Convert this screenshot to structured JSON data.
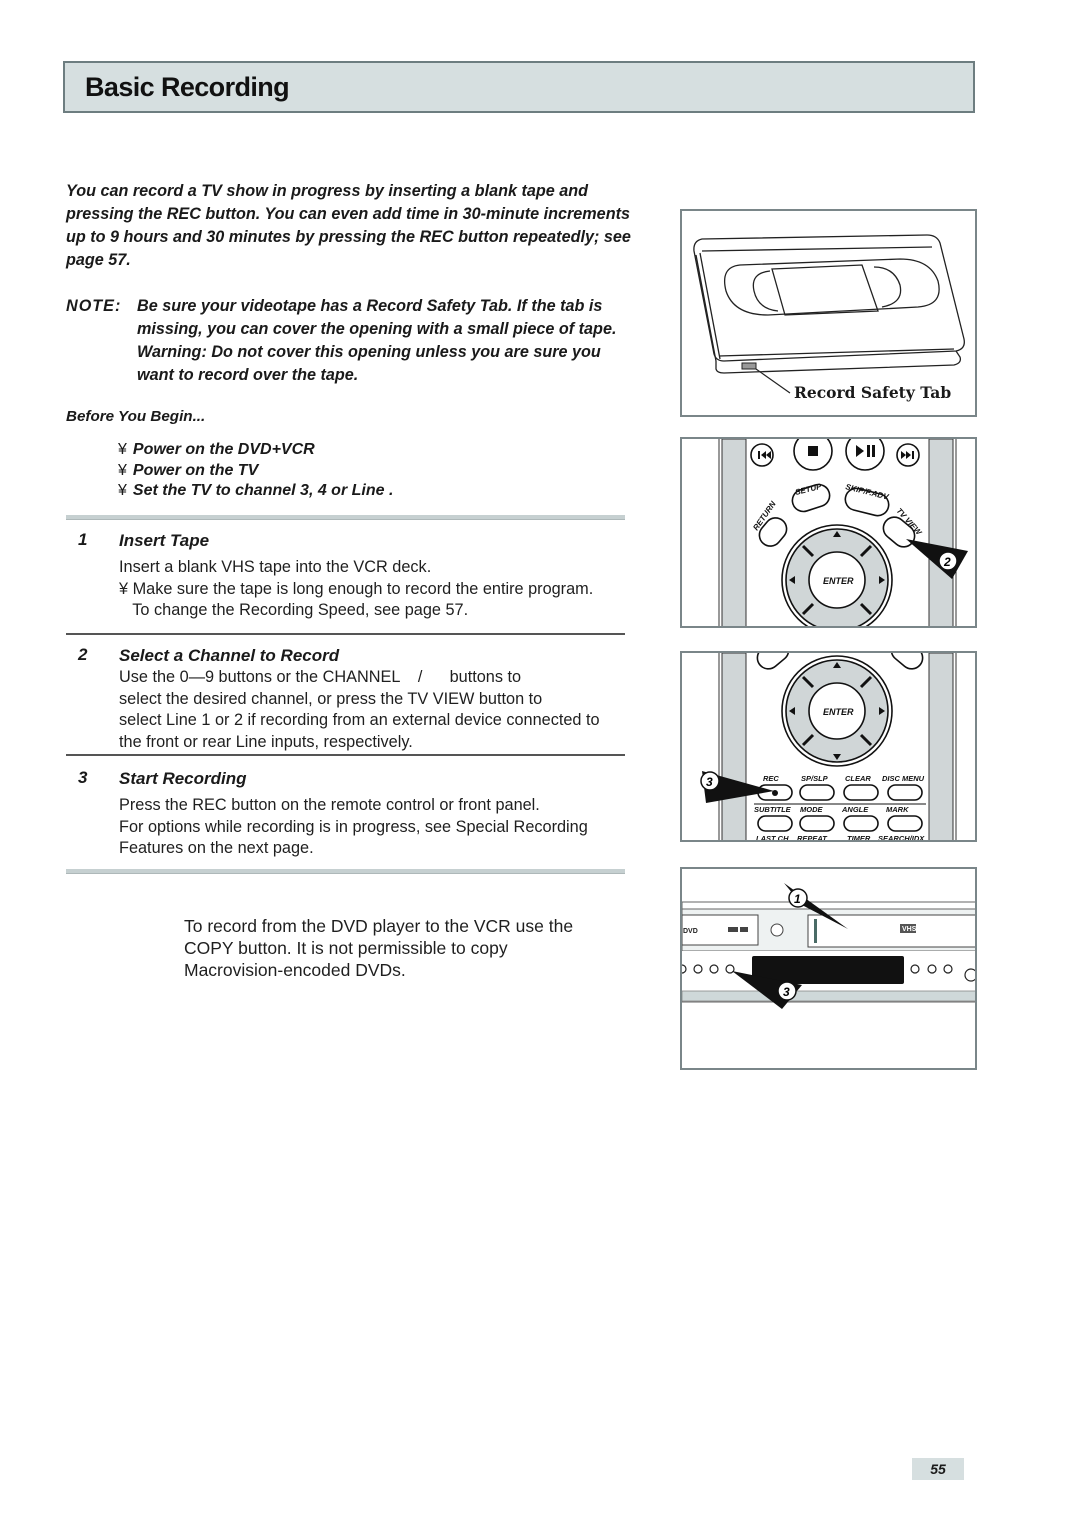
{
  "header": {
    "title": "Basic Recording"
  },
  "intro": "You can record a TV show in progress by inserting a blank tape and pressing the REC button. You can even add time in 30-minute increments up to 9 hours and 30 minutes by pressing the REC button repeatedly; see page 57.",
  "note": {
    "label": "NOTE:",
    "text": "Be sure your videotape has a Record Safety Tab. If the tab is missing, you can cover the opening with a small piece of tape. Warning: Do not cover this opening unless you are sure you want to record over the tape."
  },
  "before_you_begin": {
    "heading": "Before You Begin...",
    "bullet_glyph": "¥",
    "items": [
      "Power on the DVD+VCR",
      "Power on the TV",
      "Set the TV to channel 3, 4 or Line ."
    ]
  },
  "steps": [
    {
      "number": "1",
      "title": "Insert Tape",
      "lines": [
        "Insert a blank VHS tape into the VCR deck.",
        "¥  Make sure the tape is long enough to record the entire program.",
        "   To change the Recording Speed, see page 57."
      ]
    },
    {
      "number": "2",
      "title": "Select a Channel to Record",
      "lines": [
        "Use the 0—9 buttons or the CHANNEL    /      buttons to",
        "select the desired channel, or press the TV VIEW button to",
        "select Line 1 or 2 if recording from an external device connected to",
        "the front or rear Line inputs, respectively."
      ]
    },
    {
      "number": "3",
      "title": "Start Recording",
      "lines": [
        "Press the REC button on the remote control or front panel.",
        "For options while recording is in progress, see  Special Recording",
        "Features  on the next page."
      ]
    }
  ],
  "copy_note": [
    "To record from the DVD player to the VCR use the",
    "COPY button. It is not permissible to copy",
    "Macrovision-encoded DVDs."
  ],
  "figures": {
    "tape": {
      "caption": "Record Safety Tab"
    },
    "remote_top": {
      "buttons": [
        "SETUP",
        "SKIP/F.ADV",
        "RETURN",
        "TV VIEW",
        "ENTER"
      ],
      "callout": "2"
    },
    "remote_bottom": {
      "enter": "ENTER",
      "row1": [
        "REC",
        "SP/SLP",
        "CLEAR",
        "DISC MENU"
      ],
      "row2": [
        "SUBTITLE",
        "MODE",
        "ANGLE",
        "MARK"
      ],
      "row3": [
        "LAST CH",
        "REPEAT",
        "TIMER",
        "SEARCH/IDX"
      ],
      "callout": "3"
    },
    "front_panel": {
      "callouts": [
        "1",
        "3"
      ],
      "logo": "VHS",
      "dvd_logo": "DVD"
    }
  },
  "page_number": "55"
}
